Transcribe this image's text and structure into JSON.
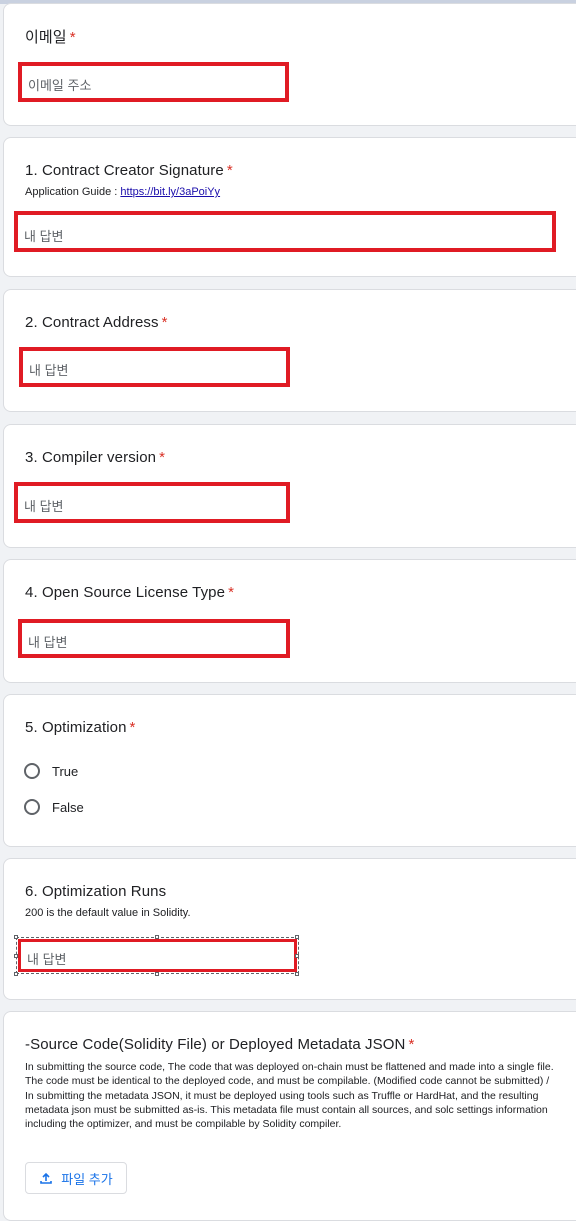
{
  "form": {
    "email": {
      "title": "이메일",
      "required_mark": "*",
      "placeholder": "이메일 주소"
    },
    "q1": {
      "title": "1. Contract Creator Signature",
      "required_mark": "*",
      "desc_prefix": "Application Guide : ",
      "desc_link": "https://bit.ly/3aPoiYy",
      "placeholder": "내 답변"
    },
    "q2": {
      "title": "2. Contract Address",
      "required_mark": "*",
      "placeholder": "내 답변"
    },
    "q3": {
      "title": "3. Compiler version",
      "required_mark": "*",
      "placeholder": "내 답변"
    },
    "q4": {
      "title": "4. Open Source License Type",
      "required_mark": "*",
      "placeholder": "내 답변"
    },
    "q5": {
      "title": "5. Optimization",
      "required_mark": "*",
      "options": [
        {
          "label": "True"
        },
        {
          "label": "False"
        }
      ]
    },
    "q6": {
      "title": "6. Optimization Runs",
      "desc": "200 is the default value in Solidity.",
      "placeholder": "내 답변"
    },
    "q7": {
      "title": "-Source Code(Solidity File) or Deployed Metadata JSON",
      "required_mark": "*",
      "desc": "In submitting the source code, The code that was deployed on-chain must be flattened and made into a single file. The code must be identical to the deployed code, and must be compilable. (Modified code cannot be submitted) / In submitting the metadata JSON, it must be deployed using tools such as Truffle or HardHat, and the resulting metadata json must be submitted as-is. This metadata file must contain all sources, and solc settings information including the optimizer, and must be compilable by Solidity compiler.",
      "upload_label": "파일 추가"
    }
  },
  "icons": {
    "upload": "upload-icon"
  },
  "colors": {
    "highlight": "#e01b24",
    "required": "#d93025",
    "link": "#1a0dab",
    "upload": "#1a73e8"
  }
}
